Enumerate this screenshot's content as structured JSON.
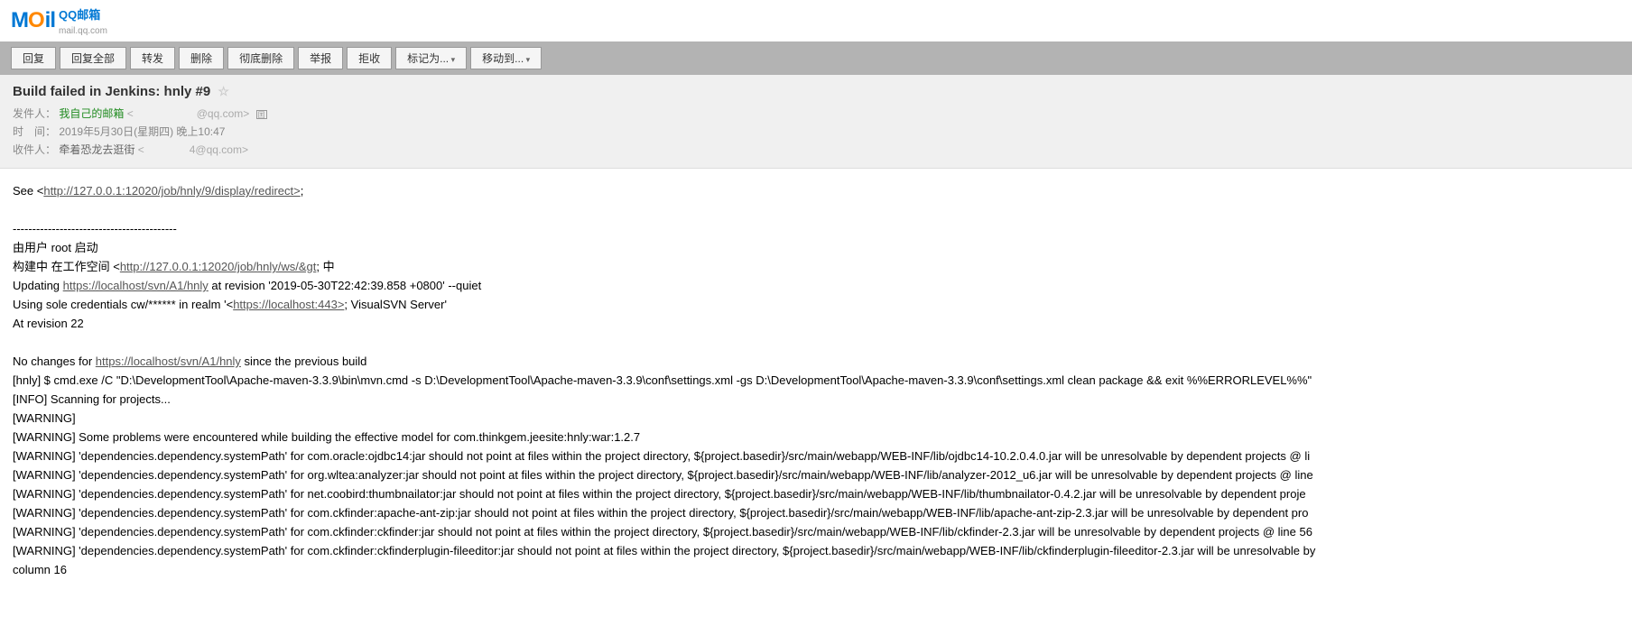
{
  "logo": {
    "m": "M",
    "o": "O",
    "il": "il",
    "title": "QQ邮箱",
    "sub": "mail.qq.com"
  },
  "toolbar": {
    "reply": "回复",
    "replyAll": "回复全部",
    "forward": "转发",
    "delete": "删除",
    "deleteForever": "彻底删除",
    "report": "举报",
    "reject": "拒收",
    "markAs": "标记为...",
    "moveTo": "移动到..."
  },
  "mail": {
    "subject": "Build failed in Jenkins: hnly #9",
    "senderLabel": "发件人：",
    "senderName": "我自己的邮箱",
    "senderEmail": "@qq.com>",
    "dateLabel": "时　间：",
    "date": "2019年5月30日(星期四) 晚上10:47",
    "recipientLabel": "收件人：",
    "recipientName": "牵着恐龙去逛街",
    "recipientEmail": "4@qq.com>"
  },
  "body": {
    "see": "See <",
    "seeUrl": "http://127.0.0.1:12020/job/hnly/9/display/redirect>",
    "seeEnd": ";",
    "dashes": "------------------------------------------",
    "started": "由用户 root 启动",
    "building1": "构建中 在工作空间 <",
    "buildingUrl": "http://127.0.0.1:12020/job/hnly/ws/&gt",
    "building2": "; 中",
    "updating1": "Updating ",
    "updatingUrl": "https://localhost/svn/A1/hnly",
    "updating2": " at revision '2019-05-30T22:42:39.858 +0800' --quiet",
    "creds1": "Using sole credentials cw/****** in realm '<",
    "credsUrl": "https://localhost:443>",
    "creds2": "; VisualSVN Server'",
    "atRev": "At revision 22",
    "noChanges1": "No changes for ",
    "noChangesUrl": "https://localhost/svn/A1/hnly",
    "noChanges2": " since the previous build",
    "cmd": "[hnly] $ cmd.exe /C \"D:\\DevelopmentTool\\Apache-maven-3.3.9\\bin\\mvn.cmd -s D:\\DevelopmentTool\\Apache-maven-3.3.9\\conf\\settings.xml -gs D:\\DevelopmentTool\\Apache-maven-3.3.9\\conf\\settings.xml clean package && exit %%ERRORLEVEL%%\"",
    "info": "[INFO] Scanning for projects...",
    "warn": "[WARNING]",
    "warn1": "[WARNING] Some problems were encountered while building the effective model for com.thinkgem.jeesite:hnly:war:1.2.7",
    "warn2": "[WARNING] 'dependencies.dependency.systemPath' for com.oracle:ojdbc14:jar should not point at files within the project directory, ${project.basedir}/src/main/webapp/WEB-INF/lib/ojdbc14-10.2.0.4.0.jar will be unresolvable by dependent projects @ li",
    "warn3": "[WARNING] 'dependencies.dependency.systemPath' for org.wltea:analyzer:jar should not point at files within the project directory, ${project.basedir}/src/main/webapp/WEB-INF/lib/analyzer-2012_u6.jar will be unresolvable by dependent projects @ line",
    "warn4": "[WARNING] 'dependencies.dependency.systemPath' for net.coobird:thumbnailator:jar should not point at files within the project directory, ${project.basedir}/src/main/webapp/WEB-INF/lib/thumbnailator-0.4.2.jar will be unresolvable by dependent proje",
    "warn5": "[WARNING] 'dependencies.dependency.systemPath' for com.ckfinder:apache-ant-zip:jar should not point at files within the project directory, ${project.basedir}/src/main/webapp/WEB-INF/lib/apache-ant-zip-2.3.jar will be unresolvable by dependent pro",
    "warn6": "[WARNING] 'dependencies.dependency.systemPath' for com.ckfinder:ckfinder:jar should not point at files within the project directory, ${project.basedir}/src/main/webapp/WEB-INF/lib/ckfinder-2.3.jar will be unresolvable by dependent projects @ line 56",
    "warn7": "[WARNING] 'dependencies.dependency.systemPath' for com.ckfinder:ckfinderplugin-fileeditor:jar should not point at files within the project directory, ${project.basedir}/src/main/webapp/WEB-INF/lib/ckfinderplugin-fileeditor-2.3.jar will be unresolvable by",
    "col16": "column 16"
  }
}
